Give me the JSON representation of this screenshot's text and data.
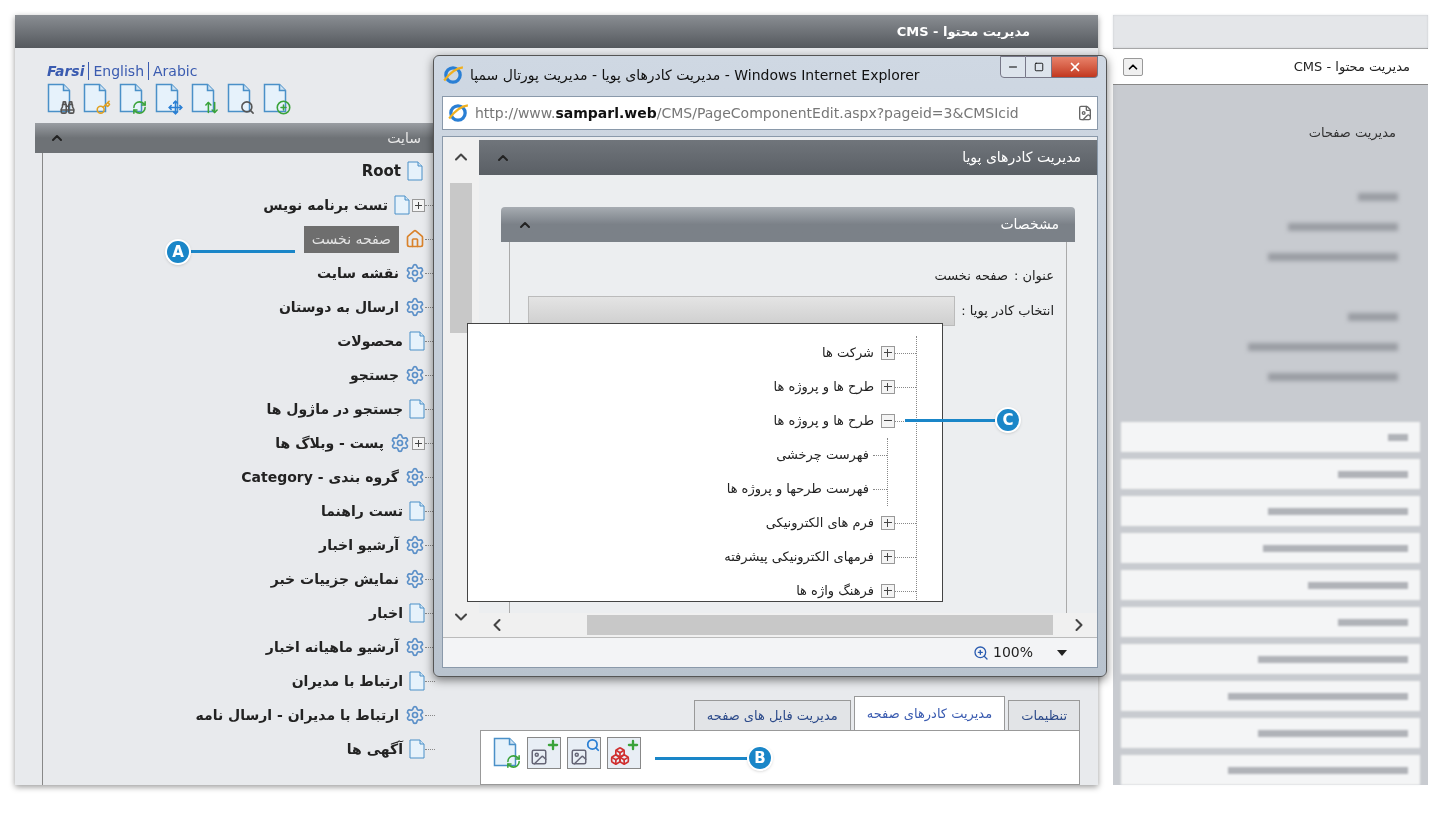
{
  "top_bar": {
    "title": "مدیریت محتوا - CMS"
  },
  "languages": [
    {
      "label": "Arabic",
      "selected": false
    },
    {
      "label": "English",
      "selected": false
    },
    {
      "label": "Farsi",
      "selected": true
    }
  ],
  "site_panel": {
    "title": "سایت",
    "tree": [
      {
        "label": "Root",
        "kind": "page",
        "expandable": false,
        "selected": false,
        "children": [
          {
            "label": "تست برنامه نویس",
            "kind": "page",
            "expandable": true,
            "selected": false
          },
          {
            "label": "صفحه نخست",
            "kind": "home",
            "expandable": false,
            "selected": true
          },
          {
            "label": "نقشه سایت",
            "kind": "gear",
            "expandable": false,
            "selected": false
          },
          {
            "label": "ارسال به دوستان",
            "kind": "gear",
            "expandable": false,
            "selected": false
          },
          {
            "label": "محصولات",
            "kind": "page",
            "expandable": false,
            "selected": false
          },
          {
            "label": "جستجو",
            "kind": "gear",
            "expandable": false,
            "selected": false
          },
          {
            "label": "جستجو در ماژول ها",
            "kind": "page",
            "expandable": false,
            "selected": false
          },
          {
            "label": "پست - وبلاگ ها",
            "kind": "gear",
            "expandable": true,
            "selected": false
          },
          {
            "label": "گروه بندی - Category",
            "kind": "gear",
            "expandable": false,
            "selected": false
          },
          {
            "label": "تست راهنما",
            "kind": "page",
            "expandable": false,
            "selected": false
          },
          {
            "label": "آرشیو اخبار",
            "kind": "gear",
            "expandable": false,
            "selected": false
          },
          {
            "label": "نمایش جزییات خبر",
            "kind": "gear",
            "expandable": false,
            "selected": false
          },
          {
            "label": "اخبار",
            "kind": "page",
            "expandable": false,
            "selected": false
          },
          {
            "label": "آرشیو ماهیانه اخبار",
            "kind": "gear",
            "expandable": false,
            "selected": false
          },
          {
            "label": "ارتباط با مدیران",
            "kind": "page",
            "expandable": false,
            "selected": false
          },
          {
            "label": "ارتباط با مدیران - ارسال نامه",
            "kind": "gear",
            "expandable": false,
            "selected": false
          },
          {
            "label": "آگهی ها",
            "kind": "page",
            "expandable": false,
            "selected": false
          }
        ]
      }
    ]
  },
  "popup": {
    "title": "مدیریت کادرهای پویا - مدیریت پورتال سمپا - Windows Internet Explorer",
    "address": "http://www.**samparl.web**/CMS/PageComponentEdit.aspx?pageid=3&CMSIcid",
    "section_title": "مدیریت کادرهای پویا",
    "panel_title": "مشخصات",
    "fields": [
      {
        "label": "عنوان :",
        "value": "صفحه نخست"
      },
      {
        "label": "انتخاب کادر پویا :"
      }
    ],
    "dropdown": [
      {
        "label": "شرکت ها",
        "expanded": false
      },
      {
        "label": "طرح ها و پروژه ها",
        "expanded": false
      },
      {
        "label": "طرح ها و پروژه ها",
        "expanded": true,
        "children": [
          {
            "label": "فهرست چرخشی"
          },
          {
            "label": "فهرست طرحها و پروژه ها"
          }
        ]
      },
      {
        "label": "فرم های الکترونیکی",
        "expanded": false
      },
      {
        "label": "فرمهای الکترونیکی پیشرفته",
        "expanded": false
      },
      {
        "label": "فرهنگ واژه ها",
        "expanded": false
      }
    ],
    "zoom": "100%"
  },
  "tabs": [
    {
      "label": "تنظیمات",
      "selected": false
    },
    {
      "label": "مدیریت کادرهای صفحه",
      "selected": true
    },
    {
      "label": "مدیریت فایل های صفحه",
      "selected": false
    }
  ],
  "sidebar": {
    "header": "مدیریت محتوا - CMS",
    "items": [
      {
        "label": "مدیریت صفحات"
      }
    ]
  },
  "callouts": [
    {
      "label": "A"
    },
    {
      "label": "B"
    },
    {
      "label": "C"
    }
  ]
}
